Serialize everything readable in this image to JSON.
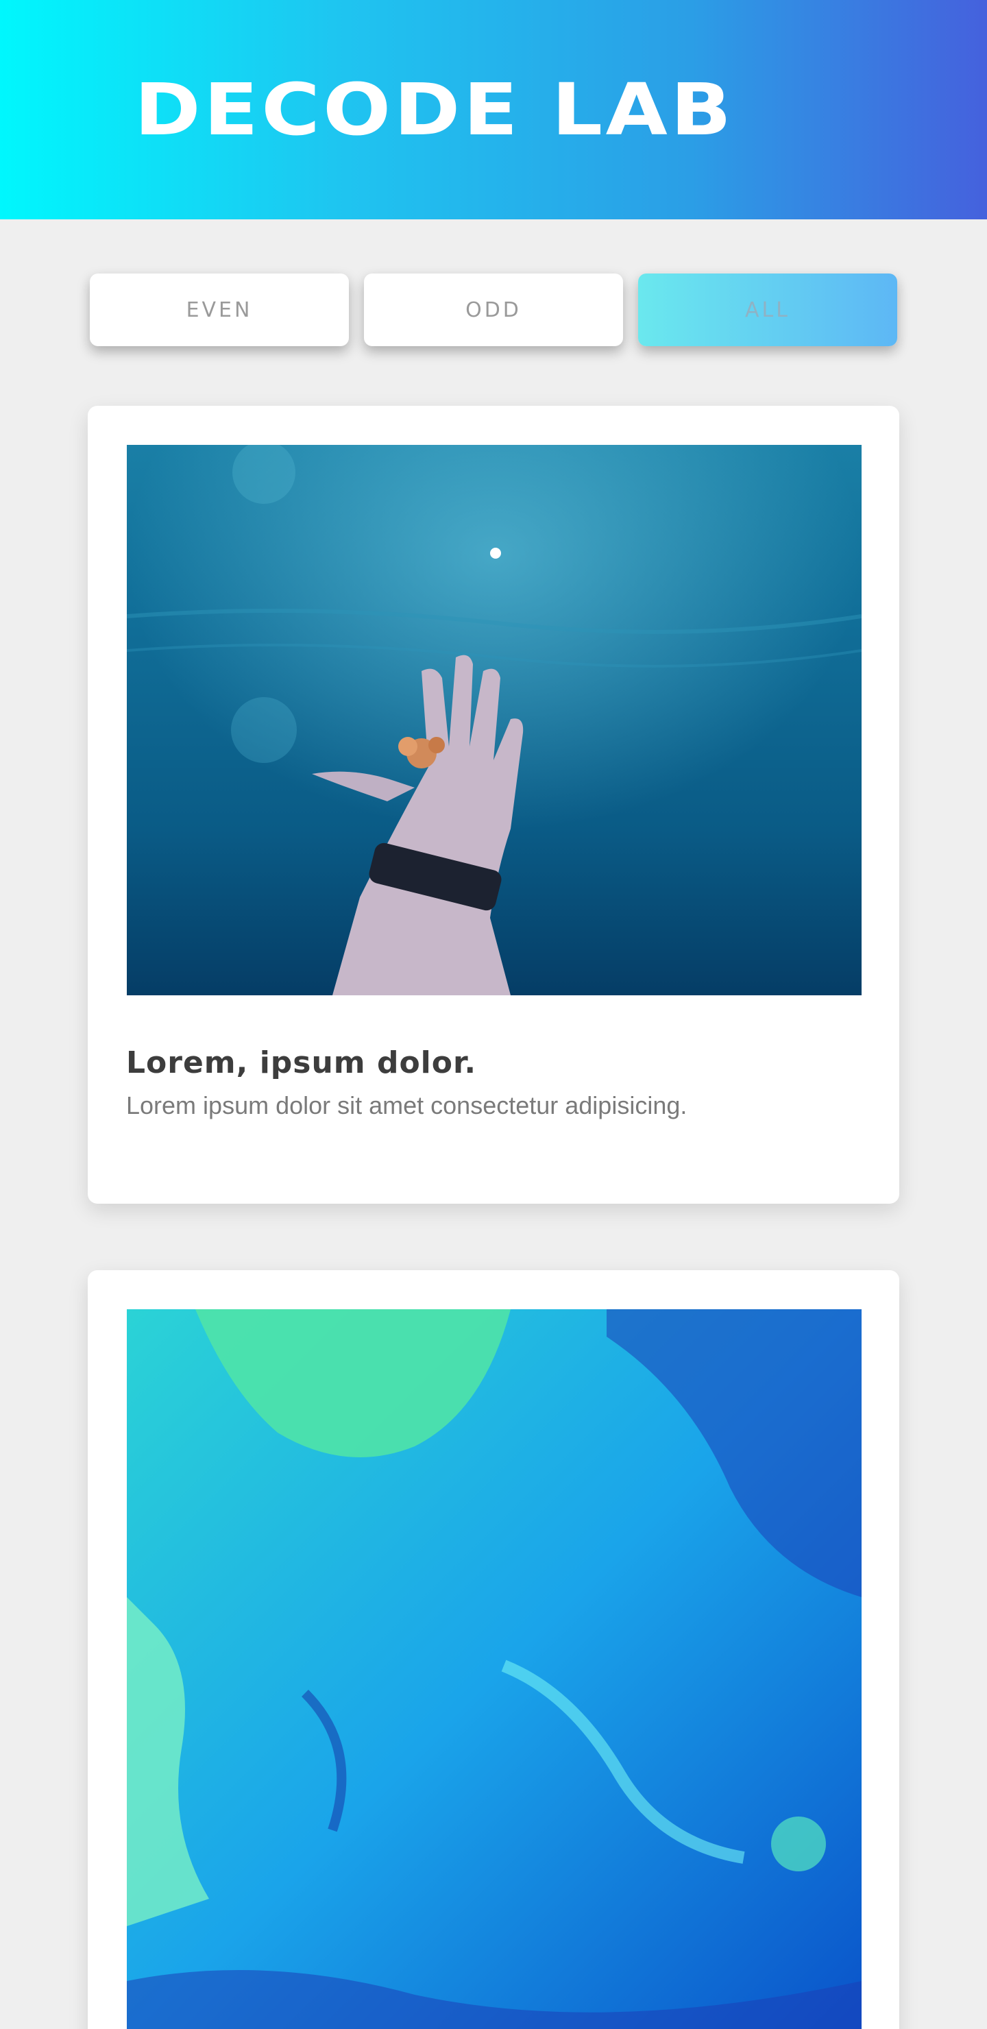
{
  "header": {
    "title": "DECODE LAB"
  },
  "filters": [
    {
      "label": "EVEN",
      "active": false
    },
    {
      "label": "ODD",
      "active": false
    },
    {
      "label": "ALL",
      "active": true
    }
  ],
  "cards": [
    {
      "title": "Lorem, ipsum dolor.",
      "text": "Lorem ipsum dolor sit amet consectetur adipisicing.",
      "image": "underwater-hand-photo"
    },
    {
      "title": "",
      "text": "",
      "image": "blue-green-marbled-fluid-photo"
    }
  ],
  "colors": {
    "header_gradient": [
      "#00f7fd",
      "#4561dd"
    ],
    "active_filter_gradient": [
      "#6ae8ee",
      "#5db7f5"
    ],
    "background": "#efefef"
  }
}
